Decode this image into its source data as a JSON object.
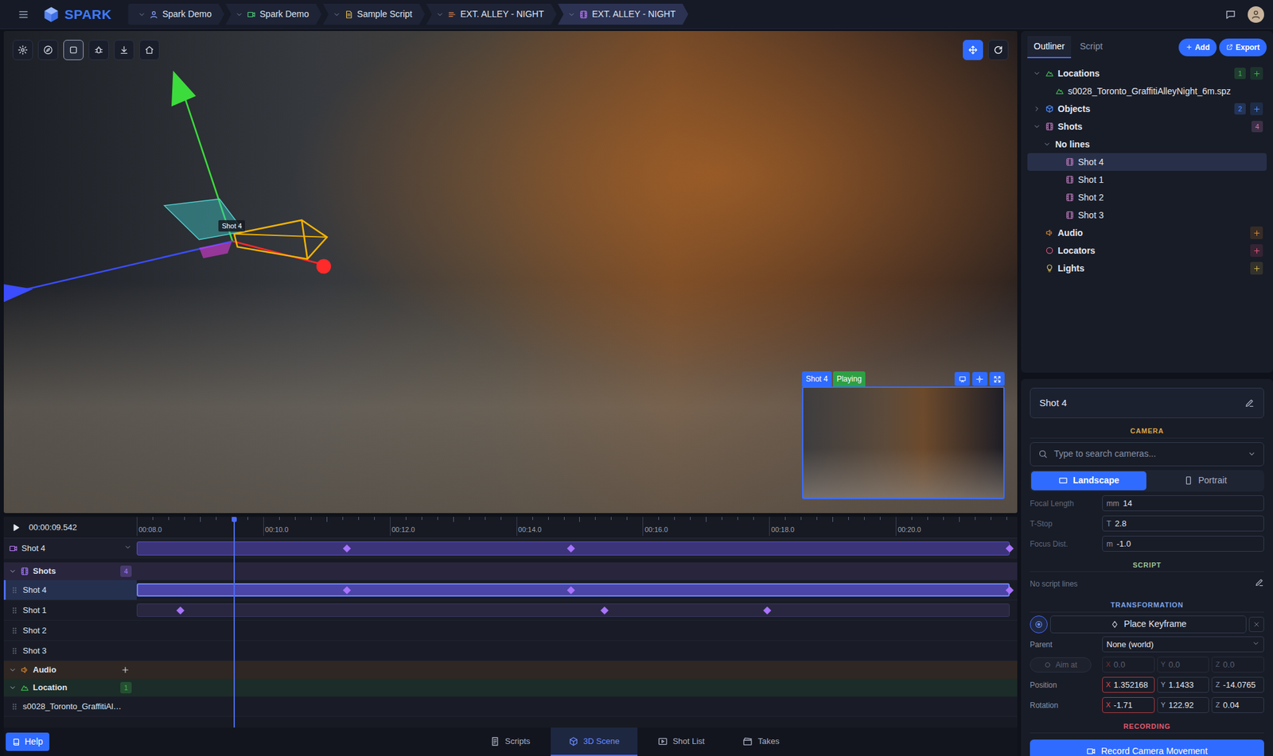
{
  "topbar": {
    "logo": "SPARK",
    "breadcrumbs": [
      {
        "label": "Spark Demo",
        "kind": "user",
        "color": "#8fa6ff",
        "selected": false
      },
      {
        "label": "Spark Demo",
        "kind": "project",
        "color": "#4fd17a",
        "selected": false
      },
      {
        "label": "Sample Script",
        "kind": "script",
        "color": "#f0c24b",
        "selected": false
      },
      {
        "label": "EXT. ALLEY - NIGHT",
        "kind": "scene",
        "color": "#f08a4b",
        "selected": false
      },
      {
        "label": "EXT. ALLEY - NIGHT",
        "kind": "shot",
        "color": "#c07bff",
        "selected": true
      }
    ]
  },
  "viewport": {
    "tools": [
      {
        "kind": "settings",
        "selected": false
      },
      {
        "kind": "compass",
        "selected": false
      },
      {
        "kind": "frame",
        "selected": true
      },
      {
        "kind": "debug",
        "selected": false
      },
      {
        "kind": "download",
        "selected": false
      },
      {
        "kind": "home",
        "selected": false
      }
    ],
    "view_tools": [
      {
        "kind": "move",
        "selected": true
      },
      {
        "kind": "refresh",
        "selected": false
      }
    ],
    "camera_label": "Shot 4",
    "preview": {
      "title": "Shot 4",
      "status": "Playing"
    }
  },
  "timeline": {
    "time": "00:00:09.542",
    "view_start": 8,
    "view_end": 21.8,
    "playhead": 9.542,
    "ticks": [
      {
        "label": "00:08.0",
        "t": 8
      },
      {
        "label": "00:10.0",
        "t": 10
      },
      {
        "label": "00:12.0",
        "t": 12
      },
      {
        "label": "00:14.0",
        "t": 14
      },
      {
        "label": "00:16.0",
        "t": 16
      },
      {
        "label": "00:18.0",
        "t": 18
      },
      {
        "label": "00:20.0",
        "t": 20
      }
    ],
    "camera_row": {
      "label": "Shot 4",
      "keyframes": [
        11.32,
        14.86,
        21.8
      ]
    },
    "groups": [
      {
        "label": "Shots",
        "kind": "shots",
        "color": "#a77bff",
        "expanded": true,
        "count": "4",
        "add": false,
        "items": [
          {
            "label": "Shot 4",
            "selected": true,
            "has_clip": true,
            "keyframes": [
              11.32,
              14.86,
              21.8
            ]
          },
          {
            "label": "Shot 1",
            "selected": false,
            "has_clip": true,
            "keyframes": [
              8.69,
              15.4,
              17.97
            ]
          },
          {
            "label": "Shot 2",
            "selected": false,
            "has_clip": false,
            "keyframes": []
          },
          {
            "label": "Shot 3",
            "selected": false,
            "has_clip": false,
            "keyframes": []
          }
        ]
      },
      {
        "label": "Audio",
        "kind": "audio",
        "color": "#e08a2c",
        "expanded": true,
        "add": true,
        "items": []
      },
      {
        "label": "Location",
        "kind": "location",
        "color": "#3fb950",
        "expanded": true,
        "count": "1",
        "add": false,
        "items": [
          {
            "label": "s0028_Toronto_GraffitiAl…",
            "selected": false,
            "has_clip": false,
            "keyframes": []
          }
        ]
      }
    ]
  },
  "footer": {
    "help": "Help",
    "tabs": [
      {
        "label": "Scripts",
        "kind": "scripts",
        "selected": false
      },
      {
        "label": "3D Scene",
        "kind": "scene3d",
        "selected": true
      },
      {
        "label": "Shot List",
        "kind": "shotlist",
        "selected": false
      },
      {
        "label": "Takes",
        "kind": "takes",
        "selected": false
      }
    ]
  },
  "outliner": {
    "tabs": [
      {
        "label": "Outliner",
        "selected": true
      },
      {
        "label": "Script",
        "selected": false
      }
    ],
    "add_button": "Add",
    "export_button": "Export",
    "tree": [
      {
        "label": "Locations",
        "level": 0,
        "kind": "location",
        "color": "#3fb950",
        "has_children": true,
        "expanded": true,
        "count": "1",
        "add": true,
        "selected": false
      },
      {
        "label": "s0028_Toronto_GraffitiAlleyNight_6m.spz",
        "level": 1,
        "kind": "file",
        "color": "#3fb950",
        "has_children": false,
        "expanded": false,
        "add": false,
        "selected": false
      },
      {
        "label": "Objects",
        "level": 0,
        "kind": "objects",
        "color": "#4c8dff",
        "has_children": true,
        "expanded": false,
        "count": "2",
        "add": true,
        "selected": false
      },
      {
        "label": "Shots",
        "level": 0,
        "kind": "shots",
        "color": "#c07bbf",
        "has_children": true,
        "expanded": true,
        "count": "4",
        "add": false,
        "selected": false
      },
      {
        "label": "No lines",
        "level": 1,
        "kind": "group",
        "color": "#9aa3b8",
        "has_children": true,
        "expanded": true,
        "add": false,
        "selected": false
      },
      {
        "label": "Shot 4",
        "level": 2,
        "kind": "shot",
        "color": "#c07bbf",
        "has_children": false,
        "expanded": false,
        "add": false,
        "selected": true
      },
      {
        "label": "Shot 1",
        "level": 2,
        "kind": "shot",
        "color": "#c07bbf",
        "has_children": false,
        "expanded": false,
        "add": false,
        "selected": false
      },
      {
        "label": "Shot 2",
        "level": 2,
        "kind": "shot",
        "color": "#c07bbf",
        "has_children": false,
        "expanded": false,
        "add": false,
        "selected": false
      },
      {
        "label": "Shot 3",
        "level": 2,
        "kind": "shot",
        "color": "#c07bbf",
        "has_children": false,
        "expanded": false,
        "add": false,
        "selected": false
      },
      {
        "label": "Audio",
        "level": 0,
        "kind": "audio",
        "color": "#e08a2c",
        "has_children": false,
        "expanded": false,
        "add": true,
        "selected": false
      },
      {
        "label": "Locators",
        "level": 0,
        "kind": "locators",
        "color": "#e0567a",
        "has_children": false,
        "expanded": false,
        "add": true,
        "selected": false
      },
      {
        "label": "Lights",
        "level": 0,
        "kind": "lights",
        "color": "#d1b450",
        "has_children": false,
        "expanded": false,
        "add": true,
        "selected": false
      }
    ]
  },
  "inspector": {
    "title": "Shot 4",
    "camera": {
      "heading": "CAMERA",
      "color": "#d9a648",
      "search_placeholder": "Type to search cameras...",
      "orientations": [
        {
          "label": "Landscape",
          "kind": "landscape",
          "selected": true
        },
        {
          "label": "Portrait",
          "kind": "portrait",
          "selected": false
        }
      ],
      "lens": [
        {
          "label": "Focal Length",
          "unit": "mm",
          "value": "14"
        },
        {
          "label": "T-Stop",
          "unit": "T",
          "value": "2.8"
        },
        {
          "label": "Focus Dist.",
          "unit": "m",
          "value": "-1.0"
        }
      ]
    },
    "script": {
      "heading": "SCRIPT",
      "color": "#9ec49a",
      "text": "No script lines"
    },
    "transformation": {
      "heading": "TRANSFORMATION",
      "color": "#7ea3e6",
      "keyframe_button": "Place Keyframe",
      "parent": {
        "label": "Parent",
        "value": "None (world)"
      },
      "aim": {
        "label": "Aim at",
        "disabled": true,
        "values": [
          {
            "axis": "X",
            "value": "0.0",
            "color": "#e5484d"
          },
          {
            "axis": "Y",
            "value": "0.0",
            "color": "#9aa3b8"
          },
          {
            "axis": "Z",
            "value": "0.0",
            "color": "#9aa3b8"
          }
        ]
      },
      "fields": [
        {
          "label": "Position",
          "values": [
            {
              "axis": "X",
              "value": "1.352168",
              "color": "#e5484d"
            },
            {
              "axis": "Y",
              "value": "1.1433",
              "color": "#9aa3b8"
            },
            {
              "axis": "Z",
              "value": "-14.0765",
              "color": "#9aa3b8"
            }
          ]
        },
        {
          "label": "Rotation",
          "values": [
            {
              "axis": "X",
              "value": "-1.71",
              "color": "#e5484d"
            },
            {
              "axis": "Y",
              "value": "122.92",
              "color": "#9aa3b8"
            },
            {
              "axis": "Z",
              "value": "0.04",
              "color": "#9aa3b8"
            }
          ]
        }
      ]
    },
    "recording": {
      "heading": "RECORDING",
      "color": "#e05a6e",
      "button": "Record Camera Movement"
    }
  }
}
